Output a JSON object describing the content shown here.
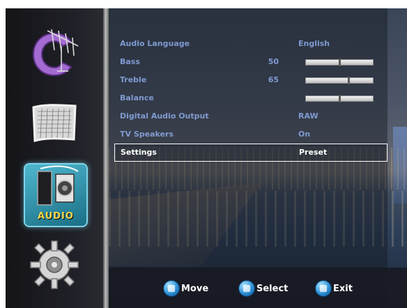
{
  "sidebar": {
    "items": [
      {
        "icon": "antenna-channel-icon"
      },
      {
        "icon": "picture-frame-icon"
      },
      {
        "icon": "speaker-audio-icon",
        "label": "AUDIO",
        "selected": true
      },
      {
        "icon": "gear-setup-icon"
      }
    ]
  },
  "menu": {
    "audio_language": {
      "label": "Audio Language",
      "value": "English"
    },
    "bass": {
      "label": "Bass",
      "value": "50",
      "level": 0.5
    },
    "treble": {
      "label": "Treble",
      "value": "65",
      "level": 0.65
    },
    "balance": {
      "label": "Balance",
      "level": 0.5
    },
    "digital_audio_output": {
      "label": "Digital Audio Output",
      "value": "RAW"
    },
    "tv_speakers": {
      "label": "TV Speakers",
      "value": "On"
    },
    "settings": {
      "label": "Settings",
      "value": "Preset",
      "selected": true
    }
  },
  "hints": {
    "move": "Move",
    "select": "Select",
    "exit": "Exit"
  },
  "colors": {
    "label_text": "#7f9ad0",
    "selected_text": "#ffffff",
    "audio_tile": "#2f9ab3",
    "audio_label": "#f6d84a"
  }
}
